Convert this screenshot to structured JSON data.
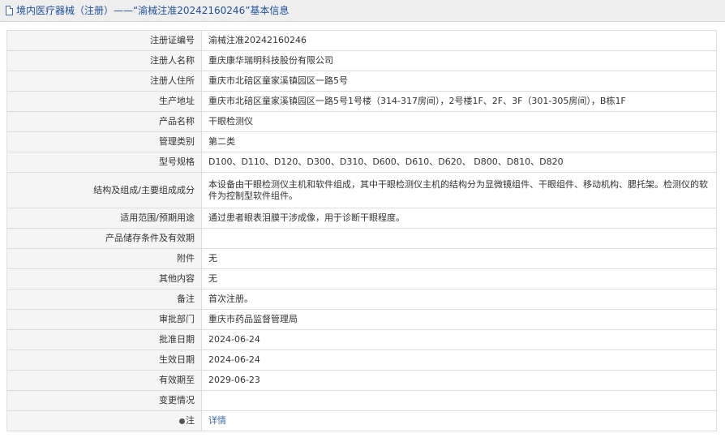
{
  "header": {
    "title": "境内医疗器械（注册）——“渝械注准20242160246”基本信息"
  },
  "rows": [
    {
      "label": "注册证编号",
      "value": "渝械注准20242160246"
    },
    {
      "label": "注册人名称",
      "value": "重庆康华瑞明科技股份有限公司"
    },
    {
      "label": "注册人住所",
      "value": "重庆市北碚区童家溪镇园区一路5号"
    },
    {
      "label": "生产地址",
      "value": "重庆市北碚区童家溪镇园区一路5号1号楼（314-317房间），2号楼1F、2F、3F（301-305房间），B栋1F"
    },
    {
      "label": "产品名称",
      "value": "干眼检测仪"
    },
    {
      "label": "管理类别",
      "value": "第二类"
    },
    {
      "label": "型号规格",
      "value": "D100、D110、D120、D300、D310、D600、D610、D620、 D800、D810、D820"
    },
    {
      "label": "结构及组成/主要组成成分",
      "value": "本设备由干眼检测仪主机和软件组成，其中干眼检测仪主机的结构分为显微镜组件、干眼组件、移动机构、腮托架。检测仪的软件为控制型软件组件。"
    },
    {
      "label": "适用范围/预期用途",
      "value": "通过患者眼表泪膜干涉成像，用于诊断干眼程度。"
    },
    {
      "label": "产品储存条件及有效期",
      "value": ""
    },
    {
      "label": "附件",
      "value": "无"
    },
    {
      "label": "其他内容",
      "value": "无"
    },
    {
      "label": "备注",
      "value": "首次注册。"
    },
    {
      "label": "审批部门",
      "value": "重庆市药品监督管理局"
    },
    {
      "label": "批准日期",
      "value": "2024-06-24"
    },
    {
      "label": "生效日期",
      "value": "2024-06-24"
    },
    {
      "label": "有效期至",
      "value": "2029-06-23"
    },
    {
      "label": "变更情况",
      "value": ""
    }
  ],
  "note": {
    "label": "注",
    "link": "详情"
  },
  "colors": {
    "title": "#1f4e9c",
    "link": "#3a6cb5",
    "label_bg": "#f5f5f5",
    "border": "#dddddd"
  }
}
